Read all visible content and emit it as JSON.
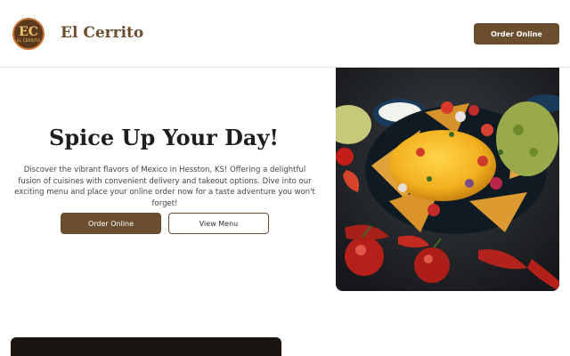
{
  "header": {
    "logo_text": "EC",
    "logo_subtext": "EL CERRITO",
    "brand_name": "El Cerrito",
    "order_button": "Order Online"
  },
  "hero": {
    "title": "Spice Up Your Day!",
    "description": "Discover the vibrant flavors of Mexico in Hesston, KS! Offering a delightful fusion of cuisines with convenient delivery and takeout options. Dive into our exciting menu and place your online order now for a taste adventure you won't forget!",
    "primary_button": "Order Online",
    "secondary_button": "View Menu",
    "image_icon": "nachos-photo"
  },
  "colors": {
    "brand_brown": "#6b4e2e",
    "dark_section": "#1a1511"
  }
}
